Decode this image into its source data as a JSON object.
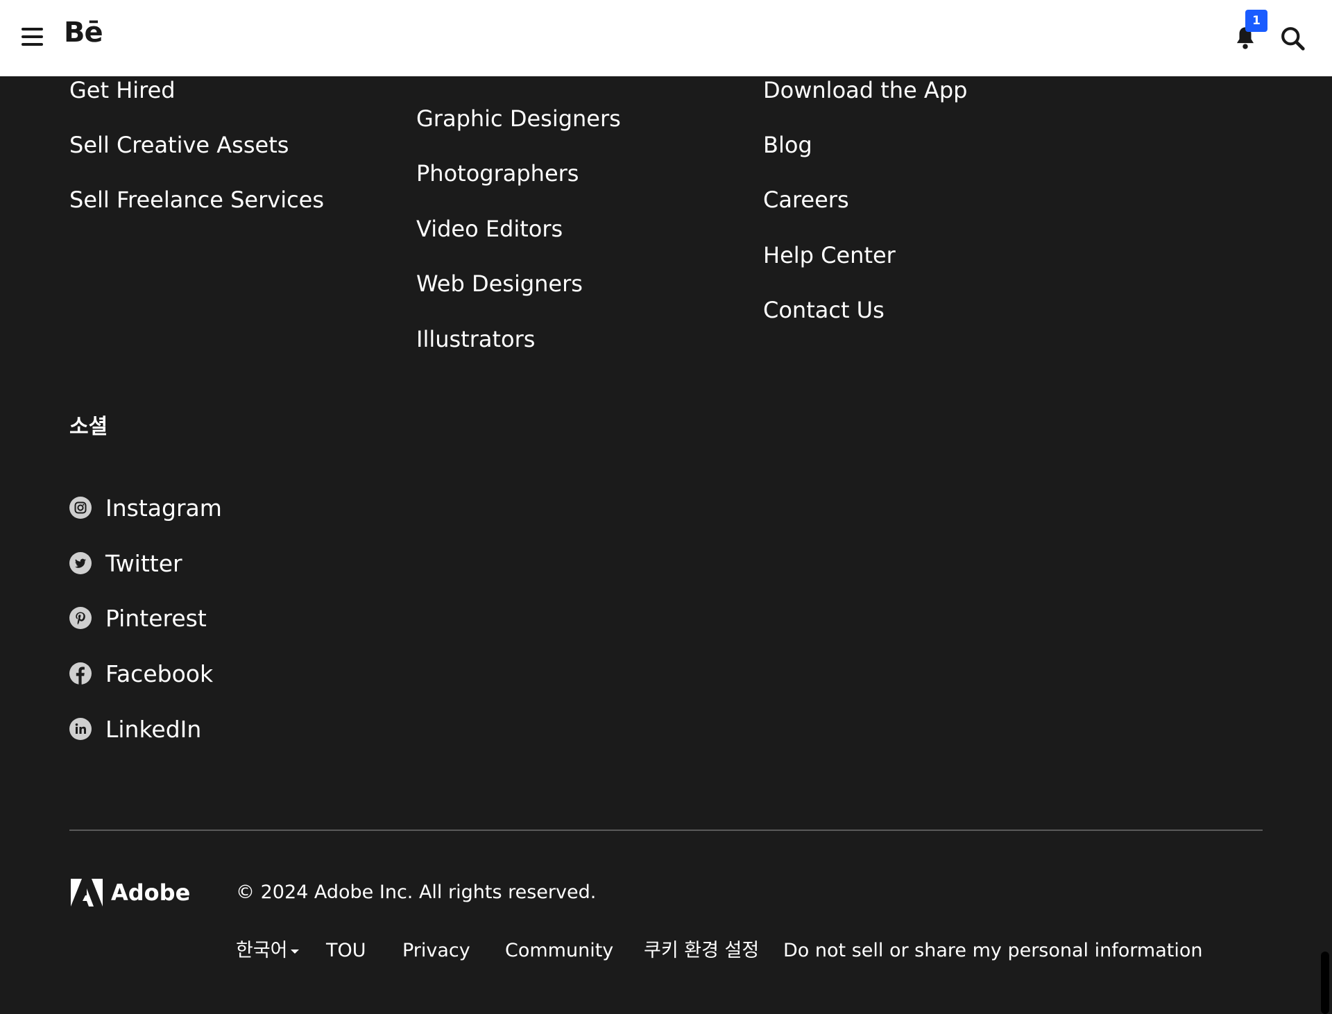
{
  "header": {
    "logo": "Bē",
    "notification_count": "1"
  },
  "footer": {
    "col1": [
      "Get Hired",
      "Sell Creative Assets",
      "Sell Freelance Services"
    ],
    "col2": [
      "Graphic Designers",
      "Photographers",
      "Video Editors",
      "Web Designers",
      "Illustrators"
    ],
    "col3": [
      "Download the App",
      "Blog",
      "Careers",
      "Help Center",
      "Contact Us"
    ],
    "social_heading": "소셜",
    "social": [
      {
        "label": "Instagram",
        "icon": "instagram-icon"
      },
      {
        "label": "Twitter",
        "icon": "twitter-icon"
      },
      {
        "label": "Pinterest",
        "icon": "pinterest-icon"
      },
      {
        "label": "Facebook",
        "icon": "facebook-icon"
      },
      {
        "label": "LinkedIn",
        "icon": "linkedin-icon"
      }
    ],
    "adobe_word": "Adobe",
    "copyright": "© 2024 Adobe Inc. All rights reserved.",
    "language": "한국어",
    "legal": [
      "TOU",
      "Privacy",
      "Community",
      "쿠키 환경 설정",
      "Do not sell or share my personal information"
    ]
  },
  "colors": {
    "background": "#1b1b1b",
    "accent": "#1a5cff"
  }
}
